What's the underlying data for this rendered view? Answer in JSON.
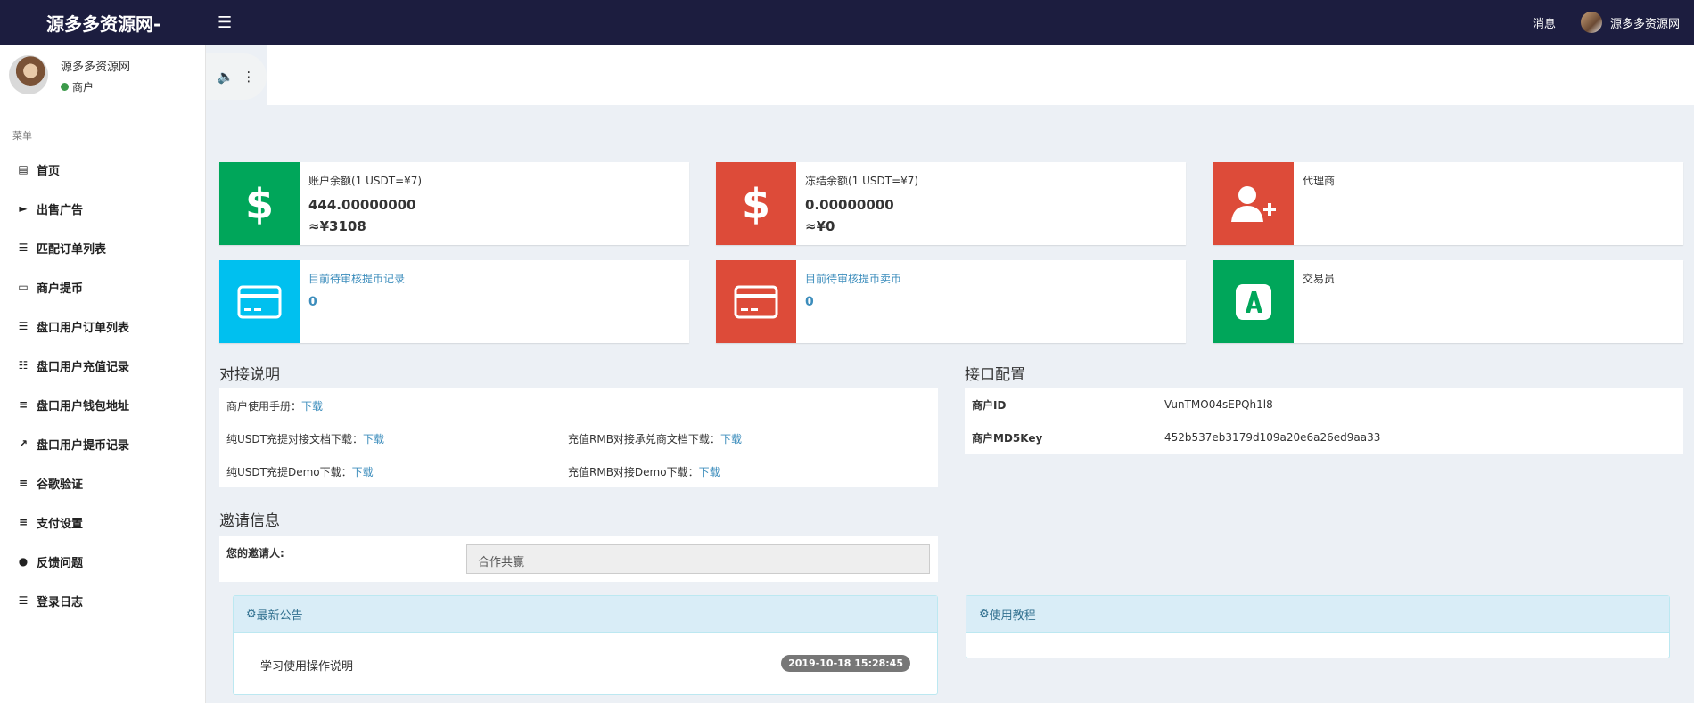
{
  "header": {
    "brand": "源多多资源网-",
    "menu_icon": "hamburger-icon",
    "messages": "消息",
    "username": "源多多资源网"
  },
  "sidebar": {
    "user_name": "源多多资源网",
    "user_role": "商户",
    "status_color": "#3c9a4a",
    "menu_header": "菜单",
    "items": [
      {
        "label": "首页",
        "icon": "bar-chart-icon"
      },
      {
        "label": "出售广告",
        "icon": "megaphone-icon"
      },
      {
        "label": "匹配订单列表",
        "icon": "list-icon"
      },
      {
        "label": "商户提币",
        "icon": "credit-card-icon"
      },
      {
        "label": "盘口用户订单列表",
        "icon": "list-icon"
      },
      {
        "label": "盘口用户充值记录",
        "icon": "clipboard-icon"
      },
      {
        "label": "盘口用户钱包地址",
        "icon": "bars-icon"
      },
      {
        "label": "盘口用户提币记录",
        "icon": "external-link-icon"
      },
      {
        "label": "谷歌验证",
        "icon": "bars-icon"
      },
      {
        "label": "支付设置",
        "icon": "bars-icon"
      },
      {
        "label": "反馈问题",
        "icon": "comment-icon"
      },
      {
        "label": "登录日志",
        "icon": "list-ol-icon"
      }
    ]
  },
  "toolbar": {
    "speaker_icon": "speaker-icon",
    "more_icon": "more-vertical-icon"
  },
  "cards": {
    "balance": {
      "label": "账户余额(1 USDT=¥7)",
      "value": "444.00000000",
      "cny": "≈¥3108"
    },
    "frozen": {
      "label": "冻结余额(1 USDT=¥7)",
      "value": "0.00000000",
      "cny": "≈¥0"
    },
    "agent": {
      "label": "代理商"
    },
    "pending_withdraw": {
      "label": "目前待审核提币记录",
      "value": "0"
    },
    "pending_sell": {
      "label": "目前待审核提币卖币",
      "value": "0"
    },
    "trader": {
      "label": "交易员"
    }
  },
  "colors": {
    "green": "#00a65a",
    "red": "#dd4b39",
    "aqua": "#00c0ef",
    "topbar": "#1c1d3f",
    "link": "#3c8dbc"
  },
  "docs": {
    "title": "对接说明",
    "manual_label": "商户使用手册：",
    "usdt_doc_label": "纯USDT充提对接文档下载：",
    "rmb_doc_label": "充值RMB对接承兑商文档下载：",
    "usdt_demo_label": "纯USDT充提Demo下载：",
    "rmb_demo_label": "充值RMB对接Demo下载：",
    "download": "下载"
  },
  "api": {
    "title": "接口配置",
    "merchant_id_label": "商户ID",
    "merchant_id": "VunTMO04sEPQh1l8",
    "md5_label": "商户MD5Key",
    "md5_key": "452b537eb3179d109a20e6a26ed9aa33"
  },
  "invite": {
    "title": "邀请信息",
    "label": "您的邀请人:",
    "value": "合作共赢"
  },
  "notice": {
    "title": "最新公告",
    "item": "学习使用操作说明",
    "date": "2019-10-18 15:28:45"
  },
  "tutorial": {
    "title": "使用教程"
  }
}
